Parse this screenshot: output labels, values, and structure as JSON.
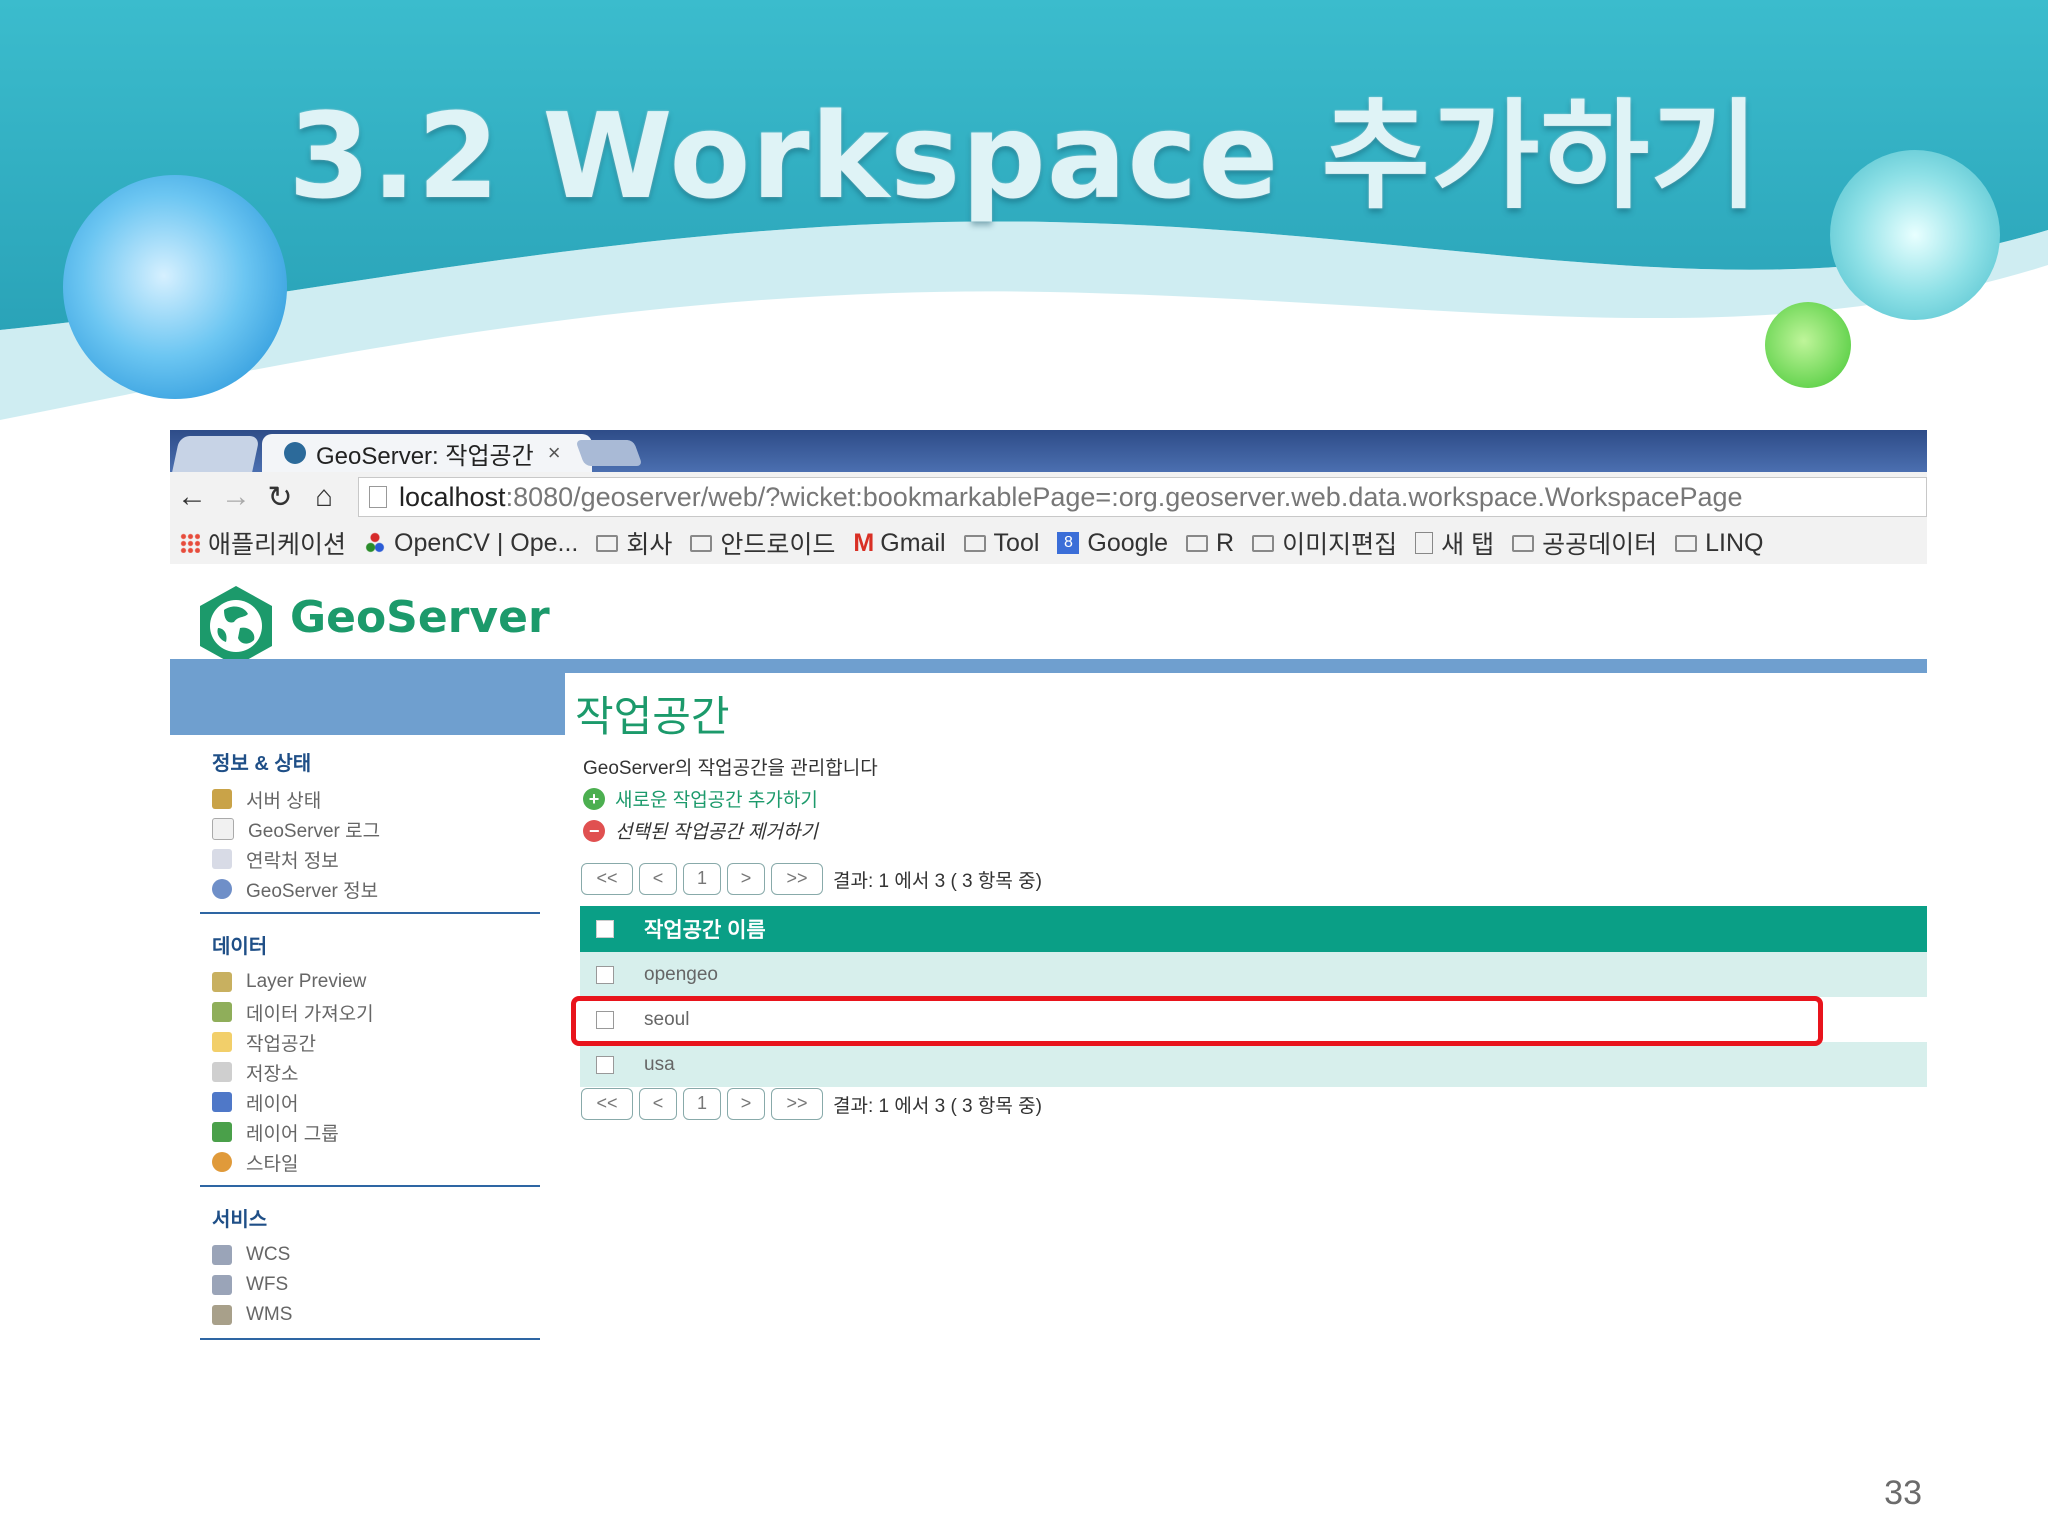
{
  "slide": {
    "title": "3.2 Workspace 추가하기",
    "page_number": "33"
  },
  "browser": {
    "tab_title": "GeoServer: 작업공간",
    "tab_close": "×",
    "url_host": "localhost",
    "url_path": ":8080/geoserver/web/?wicket:bookmarkablePage=:org.geoserver.web.data.workspace.WorkspacePage",
    "bookmarks": [
      {
        "label": "애플리케이션",
        "icon": "apps-icon"
      },
      {
        "label": "OpenCV | Ope...",
        "icon": "opencv-icon"
      },
      {
        "label": "회사",
        "icon": "folder-icon"
      },
      {
        "label": "안드로이드",
        "icon": "folder-icon"
      },
      {
        "label": "Gmail",
        "icon": "gmail-icon"
      },
      {
        "label": "Tool",
        "icon": "folder-icon"
      },
      {
        "label": "Google",
        "icon": "google-icon"
      },
      {
        "label": "R",
        "icon": "folder-icon"
      },
      {
        "label": "이미지편집",
        "icon": "folder-icon"
      },
      {
        "label": "새 탭",
        "icon": "page-icon"
      },
      {
        "label": "공공데이터",
        "icon": "folder-icon"
      },
      {
        "label": "LINQ",
        "icon": "folder-icon"
      }
    ]
  },
  "geoserver": {
    "logo_text": "GeoServer",
    "sidebar": {
      "sections": [
        {
          "title": "정보 & 상태",
          "items": [
            "서버 상태",
            "GeoServer 로그",
            "연락처 정보",
            "GeoServer 정보"
          ]
        },
        {
          "title": "데이터",
          "items": [
            "Layer Preview",
            "데이터 가져오기",
            "작업공간",
            "저장소",
            "레이어",
            "레이어 그룹",
            "스타일"
          ]
        },
        {
          "title": "서비스",
          "items": [
            "WCS",
            "WFS",
            "WMS"
          ]
        }
      ]
    },
    "page_title": "작업공간",
    "description": "GeoServer의 작업공간을 관리합니다",
    "add_action": "새로운 작업공간 추가하기",
    "remove_action": "선택된 작업공간 제거하기",
    "pager": {
      "first": "<<",
      "prev": "<",
      "page": "1",
      "next": ">",
      "last": ">>",
      "result_text": "결과: 1 에서 3 ( 3 항목 중)"
    },
    "table": {
      "header": "작업공간 이름",
      "rows": [
        "opengeo",
        "seoul",
        "usa"
      ]
    }
  },
  "colors": {
    "geoserver_green": "#1c9a6b",
    "table_header": "#0a9f86",
    "highlight_red": "#e8141c",
    "band_blue": "#6f9fcf"
  }
}
